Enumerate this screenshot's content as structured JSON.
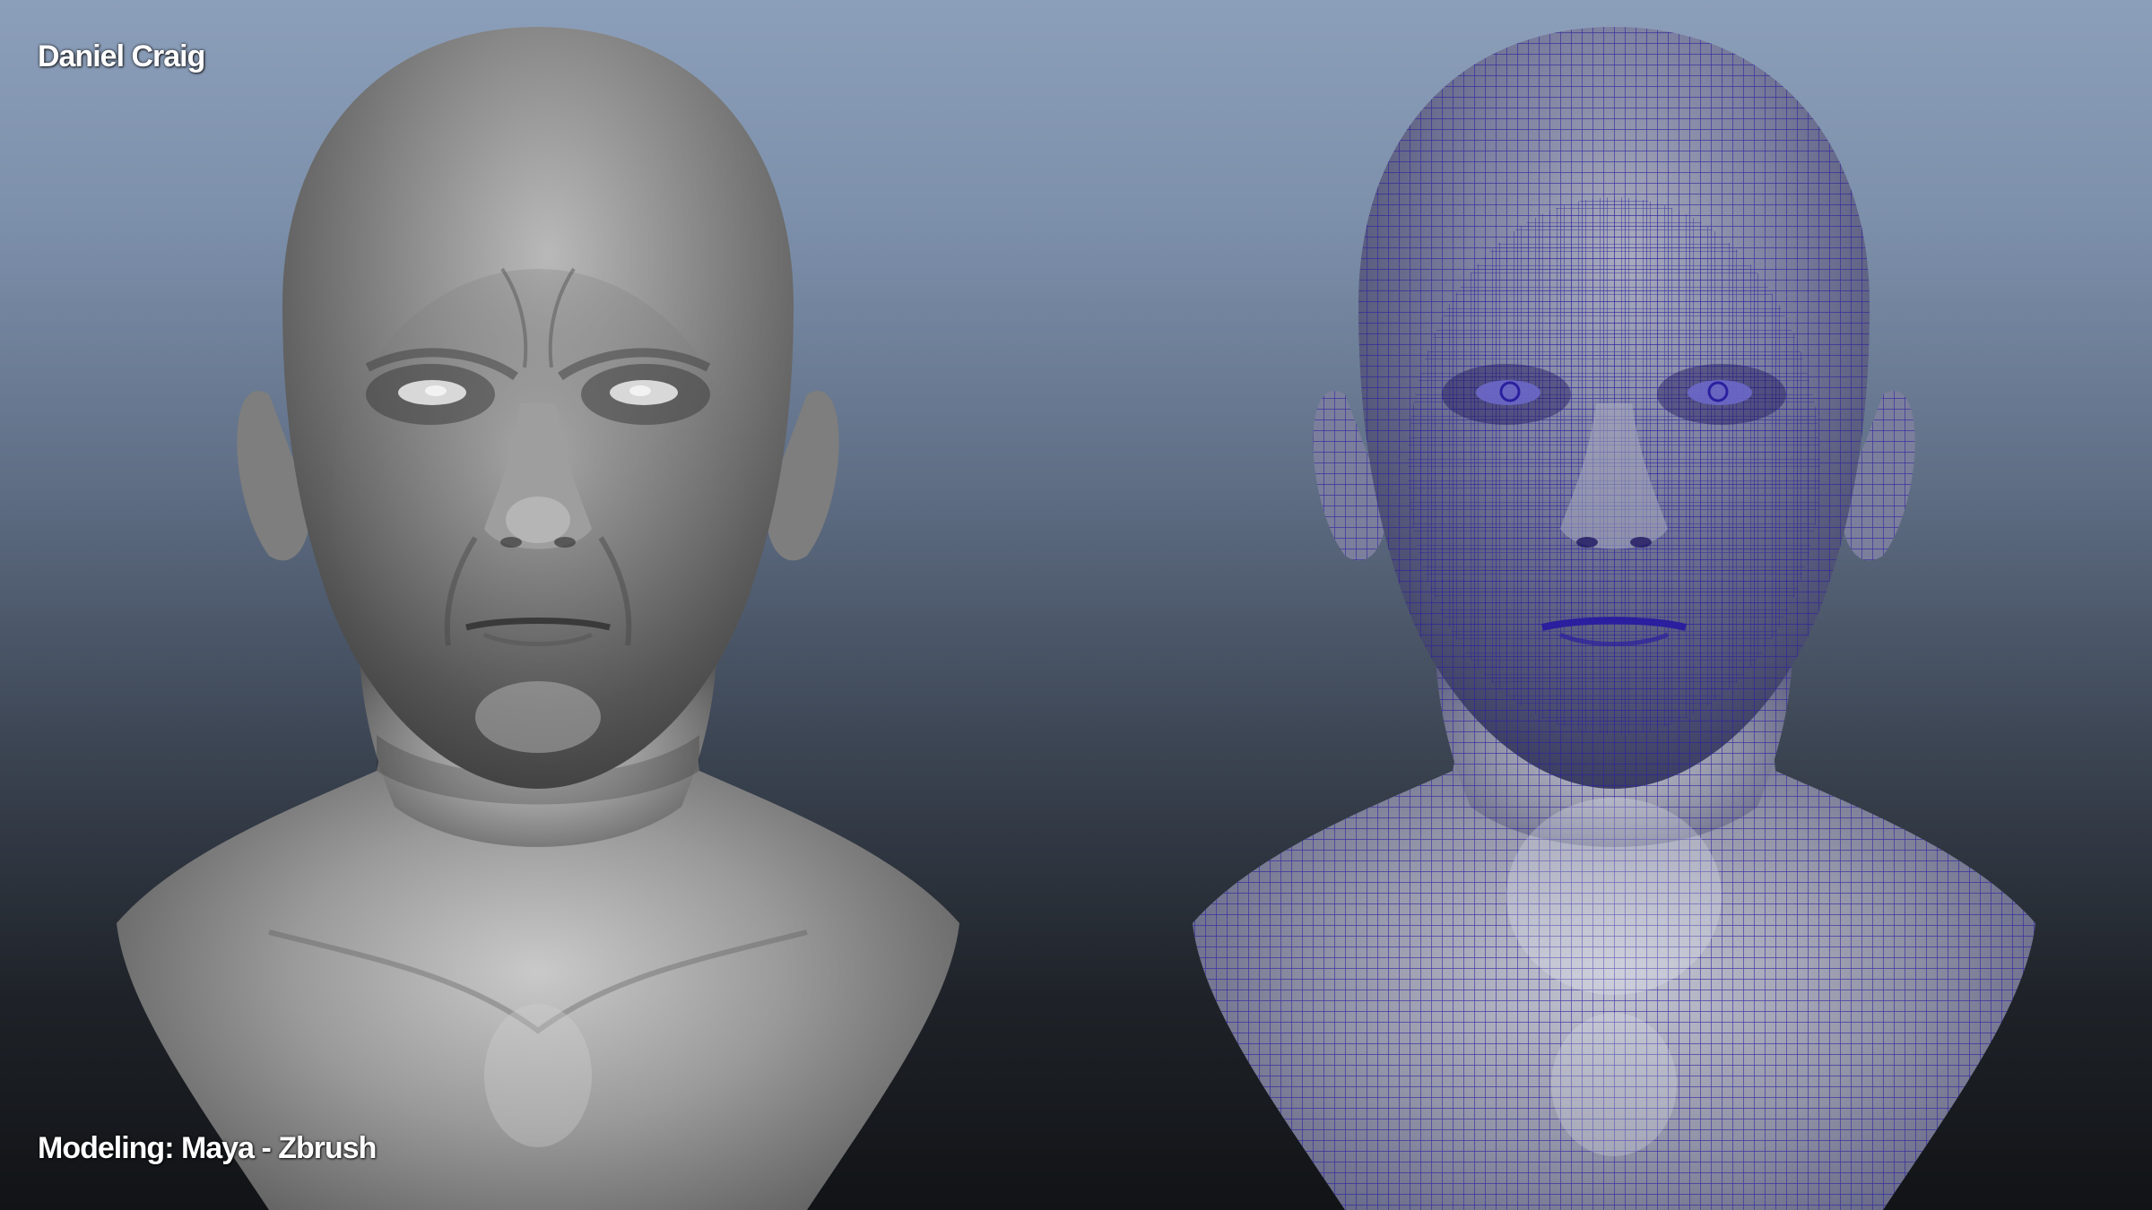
{
  "viewport": {
    "title": "Daniel Craig",
    "credit": "Modeling: Maya - Zbrush"
  },
  "panels": [
    {
      "name": "sculpt-render",
      "shading": "smooth-clay"
    },
    {
      "name": "wireframe-render",
      "shading": "wireframe-on-shaded"
    }
  ],
  "colors": {
    "clay": "#8a8a8a",
    "wire": "#2a1f9e",
    "wireframe_surface": "#8e92a6"
  }
}
